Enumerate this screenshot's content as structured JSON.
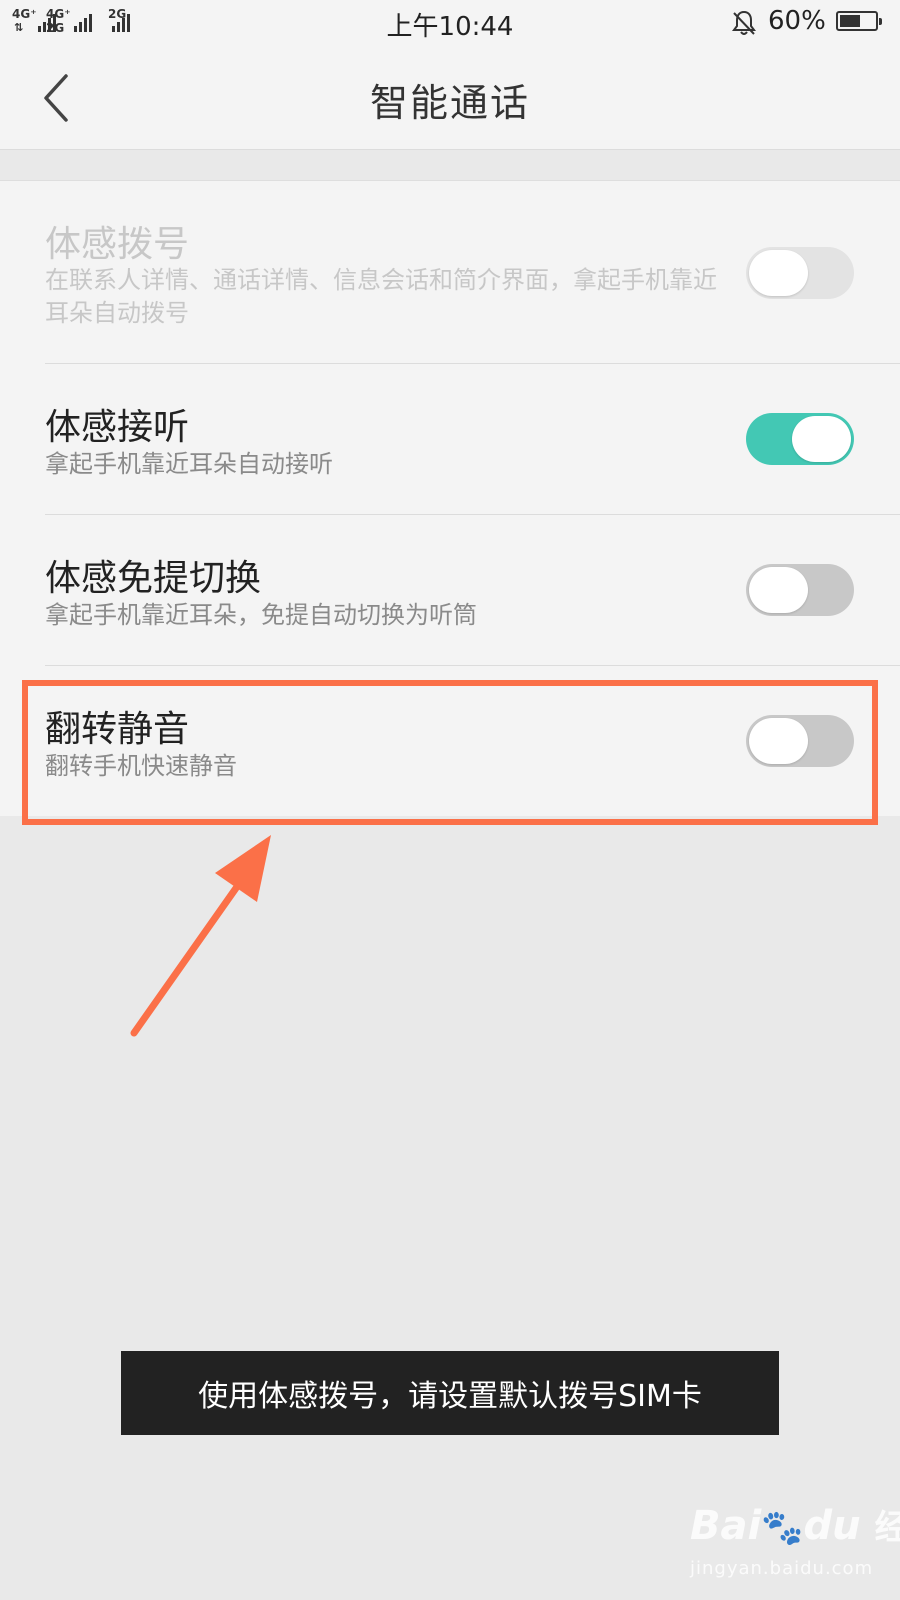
{
  "status_bar": {
    "sim1_network": "4G⁺",
    "sim2_network_top": "4G⁺",
    "sim2_network_bottom": "2G",
    "sim3_network": "2G",
    "time": "上午10:44",
    "battery_percent": "60%",
    "battery_level": 0.6,
    "icons": [
      "mobile-signal-icon",
      "silent-bell-icon",
      "battery-icon"
    ]
  },
  "header": {
    "title": "智能通话",
    "back_icon": "chevron-left-icon"
  },
  "settings": [
    {
      "title": "体感拨号",
      "description": "在联系人详情、通话详情、信息会话和简介界面，拿起手机靠近耳朵自动拨号",
      "enabled": false,
      "toggle": "off"
    },
    {
      "title": "体感接听",
      "description": "拿起手机靠近耳朵自动接听",
      "enabled": true,
      "toggle": "on"
    },
    {
      "title": "体感免提切换",
      "description": "拿起手机靠近耳朵，免提自动切换为听筒",
      "enabled": true,
      "toggle": "off"
    },
    {
      "title": "翻转静音",
      "description": "翻转手机快速静音",
      "enabled": true,
      "toggle": "off"
    }
  ],
  "toast": {
    "message": "使用体感拨号，请设置默认拨号SIM卡"
  },
  "colors": {
    "toggle_on": "#43c8b4",
    "toggle_off": "#c8c8c8",
    "annotation": "#fb7048",
    "toast_bg": "#222222"
  },
  "watermark": {
    "logo": "Bai",
    "logo_suffix": "du",
    "logo_cn": "经验",
    "url": "jingyan.baidu.com"
  }
}
